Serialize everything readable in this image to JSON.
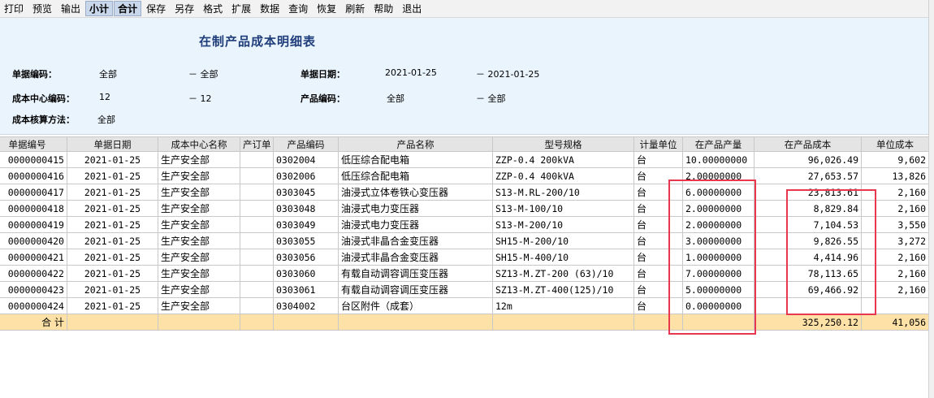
{
  "toolbar": {
    "buttons": [
      {
        "label": "打印",
        "active": false
      },
      {
        "label": "预览",
        "active": false
      },
      {
        "label": "输出",
        "active": false
      },
      {
        "label": "小计",
        "active": true
      },
      {
        "label": "合计",
        "active": true
      },
      {
        "label": "保存",
        "active": false
      },
      {
        "label": "另存",
        "active": false
      },
      {
        "label": "格式",
        "active": false
      },
      {
        "label": "扩展",
        "active": false
      },
      {
        "label": "数据",
        "active": false
      },
      {
        "label": "查询",
        "active": false
      },
      {
        "label": "恢复",
        "active": false
      },
      {
        "label": "刷新",
        "active": false
      },
      {
        "label": "帮助",
        "active": false
      },
      {
        "label": "退出",
        "active": false
      }
    ]
  },
  "report": {
    "title": "在制产品成本明细表",
    "filters": {
      "doc_no_label": "单据编码：",
      "doc_no_from": "全部",
      "doc_no_to": "－ 全部",
      "date_label": "单据日期：",
      "date_from": "2021-01-25",
      "date_to": "－ 2021-01-25",
      "cost_center_label": "成本中心编码：",
      "cost_center_from": "12",
      "cost_center_to": "－ 12",
      "product_code_label": "产品编码：",
      "product_code_from": "全部",
      "product_code_to": "－ 全部",
      "method_label": "成本核算方法：",
      "method_value": "全部"
    }
  },
  "table": {
    "columns": [
      "单据编号",
      "单据日期",
      "成本中心名称",
      "产订单",
      "产品编码",
      "产品名称",
      "型号规格",
      "计量单位",
      "在产品产量",
      "在产品成本",
      "单位成本"
    ],
    "rows": [
      [
        "0000000415",
        "2021-01-25",
        "生产安全部",
        "",
        "0302004",
        "低压综合配电箱",
        "ZZP-0.4 200kVA",
        "台",
        "10.00000000",
        "96,026.49",
        "9,602"
      ],
      [
        "0000000416",
        "2021-01-25",
        "生产安全部",
        "",
        "0302006",
        "低压综合配电箱",
        "ZZP-0.4 400kVA",
        "台",
        "2.00000000",
        "27,653.57",
        "13,826"
      ],
      [
        "0000000417",
        "2021-01-25",
        "生产安全部",
        "",
        "0303045",
        "油浸式立体卷铁心变压器",
        "S13-M.RL-200/10",
        "台",
        "6.00000000",
        "23,813.61",
        "2,160"
      ],
      [
        "0000000418",
        "2021-01-25",
        "生产安全部",
        "",
        "0303048",
        "油浸式电力变压器",
        "S13-M-100/10",
        "台",
        "2.00000000",
        "8,829.84",
        "2,160"
      ],
      [
        "0000000419",
        "2021-01-25",
        "生产安全部",
        "",
        "0303049",
        "油浸式电力变压器",
        "S13-M-200/10",
        "台",
        "2.00000000",
        "7,104.53",
        "3,550"
      ],
      [
        "0000000420",
        "2021-01-25",
        "生产安全部",
        "",
        "0303055",
        "油浸式非晶合金变压器",
        "SH15-M-200/10",
        "台",
        "3.00000000",
        "9,826.55",
        "3,272"
      ],
      [
        "0000000421",
        "2021-01-25",
        "生产安全部",
        "",
        "0303056",
        "油浸式非晶合金变压器",
        "SH15-M-400/10",
        "台",
        "1.00000000",
        "4,414.96",
        "2,160"
      ],
      [
        "0000000422",
        "2021-01-25",
        "生产安全部",
        "",
        "0303060",
        "有载自动调容调压变压器",
        "SZ13-M.ZT-200 (63)/10",
        "台",
        "7.00000000",
        "78,113.65",
        "2,160"
      ],
      [
        "0000000423",
        "2021-01-25",
        "生产安全部",
        "",
        "0303061",
        "有载自动调容调压变压器",
        "SZ13-M.ZT-400(125)/10",
        "台",
        "5.00000000",
        "69,466.92",
        "2,160"
      ],
      [
        "0000000424",
        "2021-01-25",
        "生产安全部",
        "",
        "0304002",
        "台区附件（成套）",
        "12m",
        "台",
        "0.00000000",
        "",
        ""
      ]
    ],
    "total": {
      "label": "合 计",
      "cost": "325,250.12",
      "unit_cost": "41,056"
    }
  },
  "annotations": {
    "color": "#e8384f"
  }
}
